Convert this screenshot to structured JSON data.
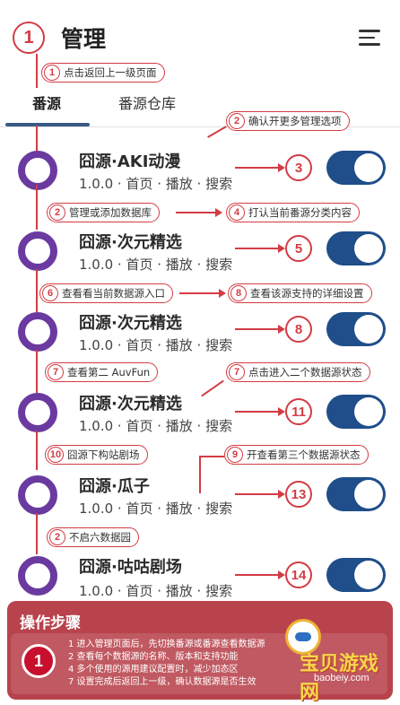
{
  "header": {
    "step": "1",
    "title": "管理",
    "menu_icon": "menu-icon"
  },
  "tabs": [
    {
      "label": "番源",
      "active": true
    },
    {
      "label": "番源仓库",
      "active": false
    }
  ],
  "sources": [
    {
      "name": "囧源·AKI动漫",
      "meta": "1.0.0 · 首页 · 播放 · 搜索",
      "step": "3",
      "enabled": true
    },
    {
      "name": "囧源·次元精选",
      "meta": "1.0.0 · 首页 · 播放 · 搜索",
      "step": "5",
      "enabled": true
    },
    {
      "name": "囧源·次元精选",
      "meta": "1.0.0 · 首页 · 播放 · 搜索",
      "step": "8",
      "enabled": true
    },
    {
      "name": "囧源·次元精选",
      "meta": "1.0.0 · 首页 · 播放 · 搜索",
      "step": "11",
      "enabled": true
    },
    {
      "name": "囧源·瓜子",
      "meta": "1.0.0 · 首页 · 播放 · 搜索",
      "step": "13",
      "enabled": true
    },
    {
      "name": "囧源·咕咕剧场",
      "meta": "1.0.0 · 首页 · 播放 · 搜索",
      "step": "14",
      "enabled": true
    }
  ],
  "callouts": {
    "c1": {
      "num": "1",
      "text": "点击返回上一级页面"
    },
    "c2": {
      "num": "2",
      "text": "确认开更多管理选项"
    },
    "c3": {
      "num": "2",
      "text": "管理或添加数据库"
    },
    "c4": {
      "num": "4",
      "text": "打认当前番源分类内容"
    },
    "c5": {
      "num": "6",
      "text": "查看看当前数据源入口"
    },
    "c6": {
      "num": "8",
      "text": "查看该源支持的详细设置"
    },
    "c7": {
      "num": "7",
      "text": "查看第二 AuvFun"
    },
    "c8": {
      "num": "7",
      "text": "点击进入二个数据源状态"
    },
    "c9": {
      "num": "10",
      "text": "囧源下构站剧场"
    },
    "c10": {
      "num": "9",
      "text": "开查看第三个数据源状态"
    },
    "c11": {
      "num": "2",
      "text": "不启六数据园"
    }
  },
  "steps_panel": {
    "title": "操作步骤",
    "num": "1",
    "lines": [
      "1 进入管理页面后，先切换番源或番源查看数据源",
      "2 查看每个数据源的名称、版本和支持功能",
      "4 多个使用的源用建议配置时，减少加态区",
      "7 设置完成后返回上一级，确认数据源是否生效"
    ]
  },
  "watermark": {
    "text": "宝贝游戏网",
    "url": "baobeiy.com"
  },
  "colors": {
    "accent": "#d33c44",
    "ring": "#6b3aa0",
    "toggle": "#1f4e8a",
    "panel": "#b8434c"
  }
}
